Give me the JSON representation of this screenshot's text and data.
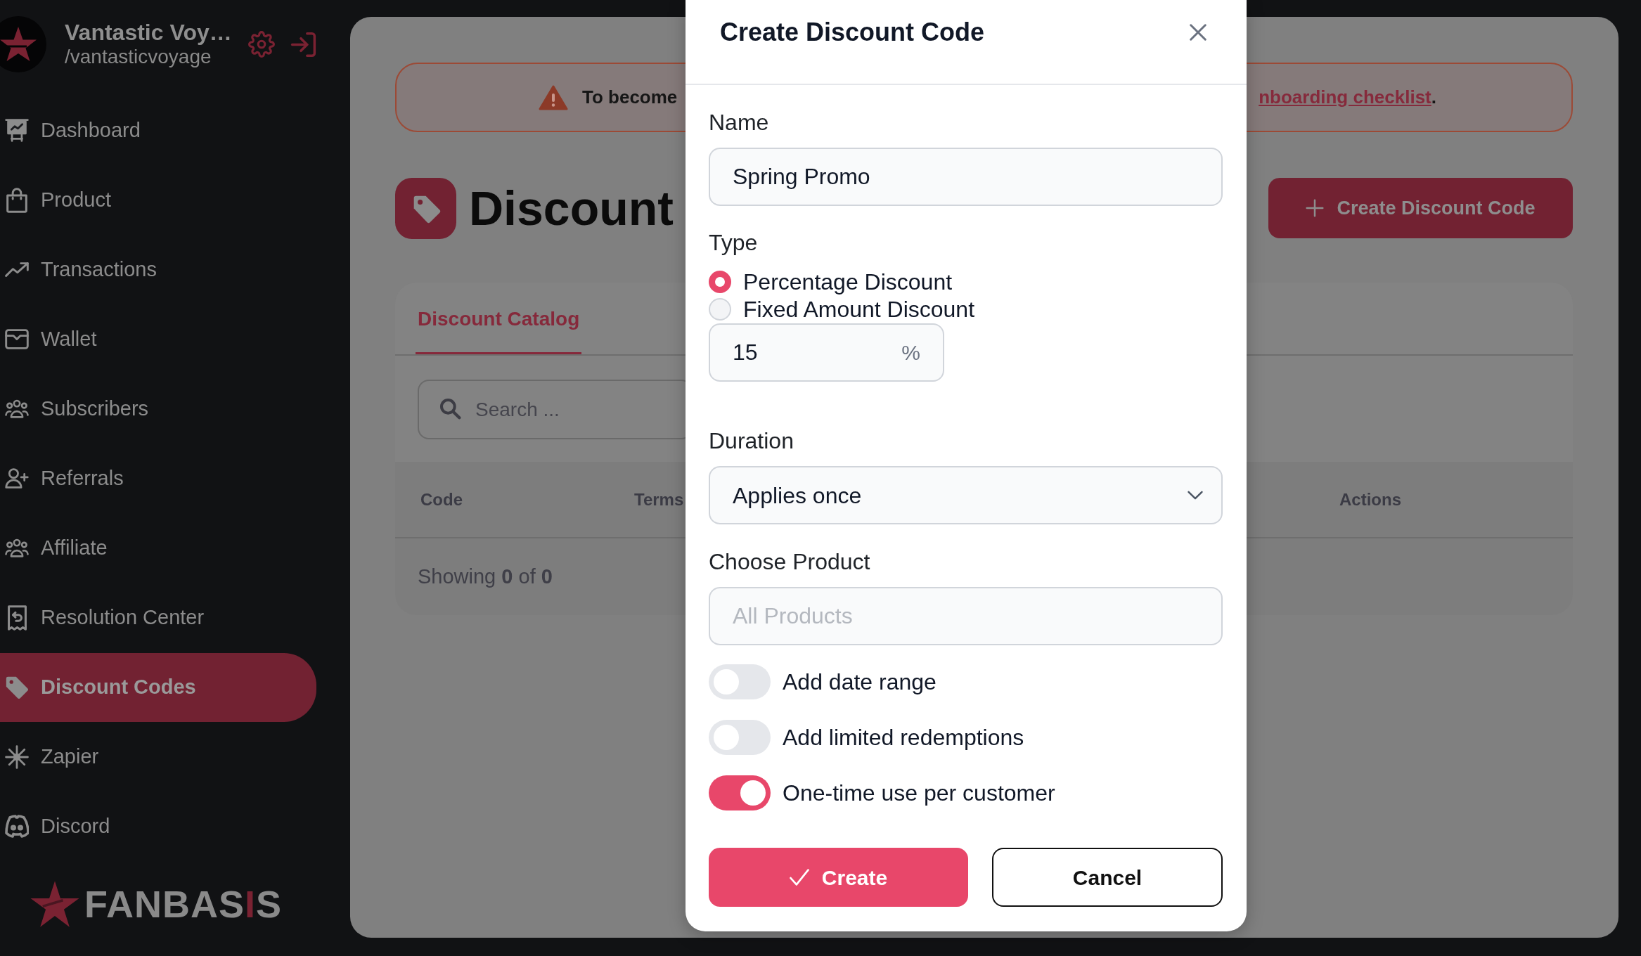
{
  "sidebar": {
    "account": {
      "name": "Vantastic Voy…",
      "handle": "/vantasticvoyage"
    },
    "items": [
      {
        "label": "Dashboard",
        "selected": false
      },
      {
        "label": "Product",
        "selected": false
      },
      {
        "label": "Transactions",
        "selected": false
      },
      {
        "label": "Wallet",
        "selected": false
      },
      {
        "label": "Subscribers",
        "selected": false
      },
      {
        "label": "Referrals",
        "selected": false
      },
      {
        "label": "Affiliate",
        "selected": false
      },
      {
        "label": "Resolution Center",
        "selected": false
      },
      {
        "label": "Discount Codes",
        "selected": true
      },
      {
        "label": "Zapier",
        "selected": false
      },
      {
        "label": "Discord",
        "selected": false
      }
    ],
    "logo": {
      "parts": [
        {
          "text": "FANBAS",
          "accent": false
        },
        {
          "text": "I",
          "accent": true
        },
        {
          "text": "S",
          "accent": false
        }
      ]
    }
  },
  "alert": {
    "text": "To become",
    "link": "nboarding checklist",
    "end": "."
  },
  "page": {
    "title": "Discount",
    "create_button": "Create Discount Code"
  },
  "catalog": {
    "tabs": [
      {
        "label": "Discount Catalog",
        "selected": true
      }
    ],
    "search": {
      "placeholder": "Search ..."
    },
    "columns": [
      "Code",
      "Terms",
      "Actions"
    ],
    "footer": "Showing **0** of **0**"
  },
  "modal": {
    "title": "Create Discount Code",
    "name": {
      "label": "Name",
      "value": "Spring Promo"
    },
    "type": {
      "label": "Type",
      "options": [
        {
          "label": "Percentage Discount",
          "selected": true
        },
        {
          "label": "Fixed Amount Discount",
          "selected": false
        }
      ],
      "amount": {
        "value": "15",
        "unit": "%"
      }
    },
    "duration": {
      "label": "Duration",
      "value": "Applies once"
    },
    "product": {
      "label": "Choose Product",
      "placeholder": "All Products"
    },
    "toggles": [
      {
        "label": "Add date range",
        "on": false
      },
      {
        "label": "Add limited redemptions",
        "on": false
      },
      {
        "label": "One-time use per customer",
        "on": true
      }
    ],
    "buttons": [
      {
        "label": "Create",
        "kind": "primary"
      },
      {
        "label": "Cancel",
        "kind": "secondary"
      }
    ]
  }
}
